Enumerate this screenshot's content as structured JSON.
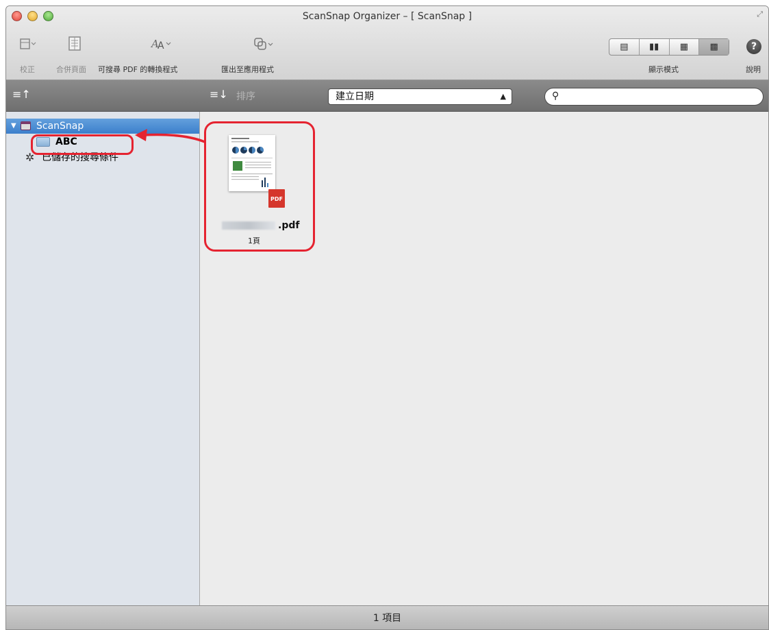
{
  "window": {
    "title": "ScanSnap Organizer – [ ScanSnap ]"
  },
  "toolbar": {
    "correct_label": "校正",
    "merge_label": "合併頁面",
    "searchable_pdf_label": "可搜尋 PDF 的轉換程式",
    "export_label": "匯出至應用程式",
    "view_mode_label": "顯示模式",
    "help_label": "說明"
  },
  "sortbar": {
    "sort_label": "排序",
    "sort_value": "建立日期",
    "search_placeholder": ""
  },
  "sidebar": {
    "items": [
      {
        "label": "ScanSnap",
        "icon": "scansnap-folder-icon",
        "selected": true
      },
      {
        "label": "ABC",
        "icon": "folder-icon"
      },
      {
        "label": "已儲存的搜尋條件",
        "icon": "gear-icon"
      }
    ]
  },
  "content": {
    "file": {
      "name_suffix": ".pdf",
      "pages": "1頁",
      "badge": "PDF"
    }
  },
  "status": {
    "text": "1 項目"
  },
  "colors": {
    "selection": "#3c7fcb",
    "highlight": "#e52330",
    "pdf_badge": "#d5362c"
  }
}
